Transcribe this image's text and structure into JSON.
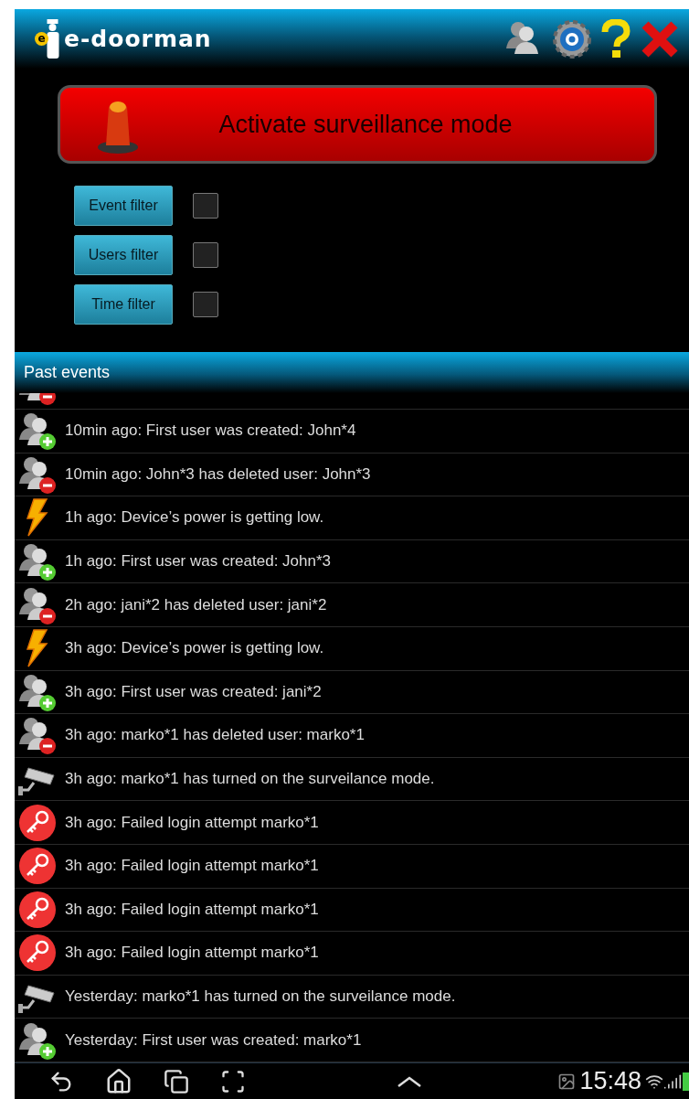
{
  "app": {
    "title": "e-doorman",
    "logo_letter": "e"
  },
  "toolbar": [
    {
      "kind": "users"
    },
    {
      "kind": "settings"
    },
    {
      "kind": "help"
    },
    {
      "kind": "close"
    }
  ],
  "alarm_button": {
    "label": "Activate surveillance mode"
  },
  "filters": [
    {
      "label": "Event filter",
      "checked": false
    },
    {
      "label": "Users filter",
      "checked": false
    },
    {
      "label": "Time filter",
      "checked": false
    }
  ],
  "past_events": {
    "title": "Past events",
    "items": [
      {
        "kind": "user-add",
        "text": "10min ago: First user was created: John*4"
      },
      {
        "kind": "user-delete",
        "text": "10min ago: John*3 has deleted user: John*3"
      },
      {
        "kind": "power",
        "text": "1h ago: Device’s power is getting low."
      },
      {
        "kind": "user-add",
        "text": "1h ago: First user was created: John*3"
      },
      {
        "kind": "user-delete",
        "text": "2h ago: jani*2 has deleted user: jani*2"
      },
      {
        "kind": "power",
        "text": "3h ago: Device’s power is getting low."
      },
      {
        "kind": "user-add",
        "text": "3h ago: First user was created: jani*2"
      },
      {
        "kind": "user-delete",
        "text": "3h ago: marko*1 has deleted user: marko*1"
      },
      {
        "kind": "camera",
        "text": "3h ago: marko*1 has turned on the surveilance mode."
      },
      {
        "kind": "login-fail",
        "text": "3h ago: Failed login attempt marko*1"
      },
      {
        "kind": "login-fail",
        "text": "3h ago: Failed login attempt marko*1"
      },
      {
        "kind": "login-fail",
        "text": "3h ago: Failed login attempt marko*1"
      },
      {
        "kind": "login-fail",
        "text": "3h ago: Failed login attempt marko*1"
      },
      {
        "kind": "camera",
        "text": "Yesterday: marko*1 has turned on the surveilance mode."
      },
      {
        "kind": "user-add",
        "text": "Yesterday: First user was created: marko*1"
      }
    ]
  },
  "status_bar": {
    "time": "15:48"
  }
}
